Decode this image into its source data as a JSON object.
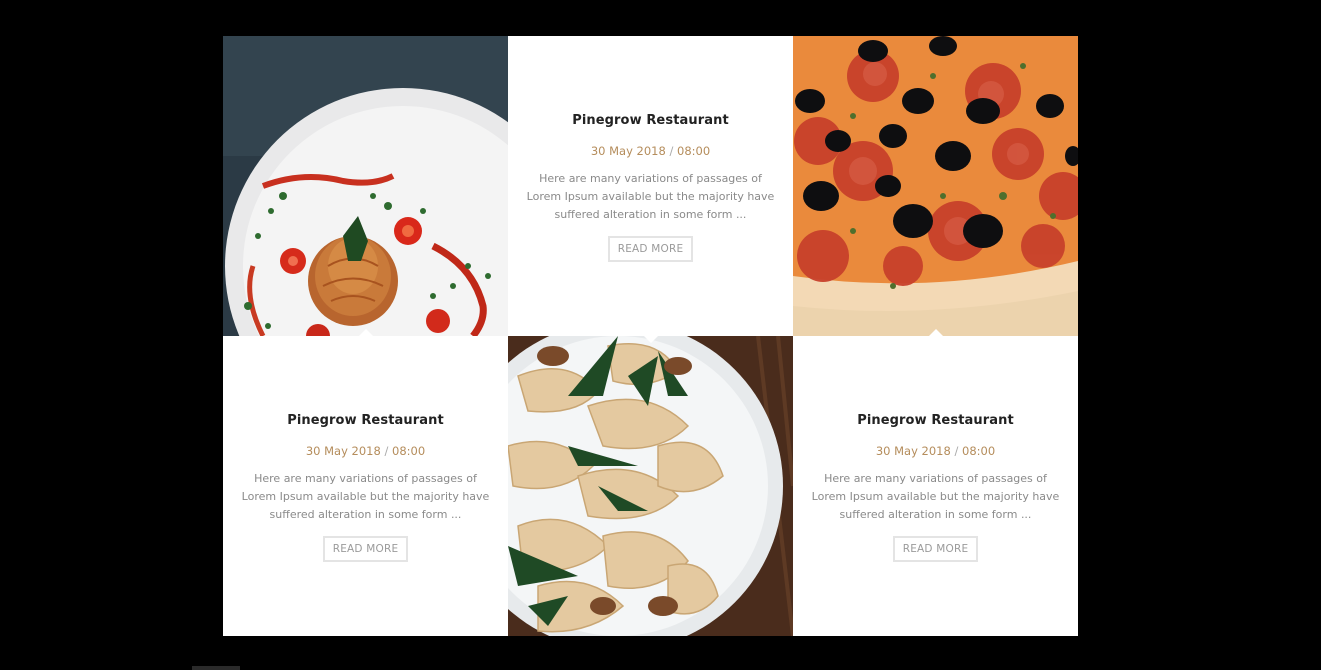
{
  "cards": [
    {
      "title": "Pinegrow Restaurant",
      "date": "30 May 2018",
      "separator": "/",
      "time": "08:00",
      "description": "Here are many variations of passages of Lorem Ipsum available but the majority have suffered alteration in some form ...",
      "button": "READ MORE"
    },
    {
      "title": "Pinegrow Restaurant",
      "date": "30 May 2018",
      "separator": "/",
      "time": "08:00",
      "description": "Here are many variations of passages of Lorem Ipsum available but the majority have suffered alteration in some form ...",
      "button": "READ MORE"
    },
    {
      "title": "Pinegrow Restaurant",
      "date": "30 May 2018",
      "separator": "/",
      "time": "08:00",
      "description": "Here are many variations of passages of Lorem Ipsum available but the majority have suffered alteration in some form ...",
      "button": "READ MORE"
    }
  ],
  "photos": [
    {
      "name": "spaghetti-photo"
    },
    {
      "name": "pizza-photo"
    },
    {
      "name": "pappardelle-photo"
    }
  ],
  "colors": {
    "page_background": "#000000",
    "card_background": "#ffffff",
    "title": "#222222",
    "date_accent": "#b58d5c",
    "body_text": "#8a8a8a",
    "button_border": "#e4e4e4"
  }
}
